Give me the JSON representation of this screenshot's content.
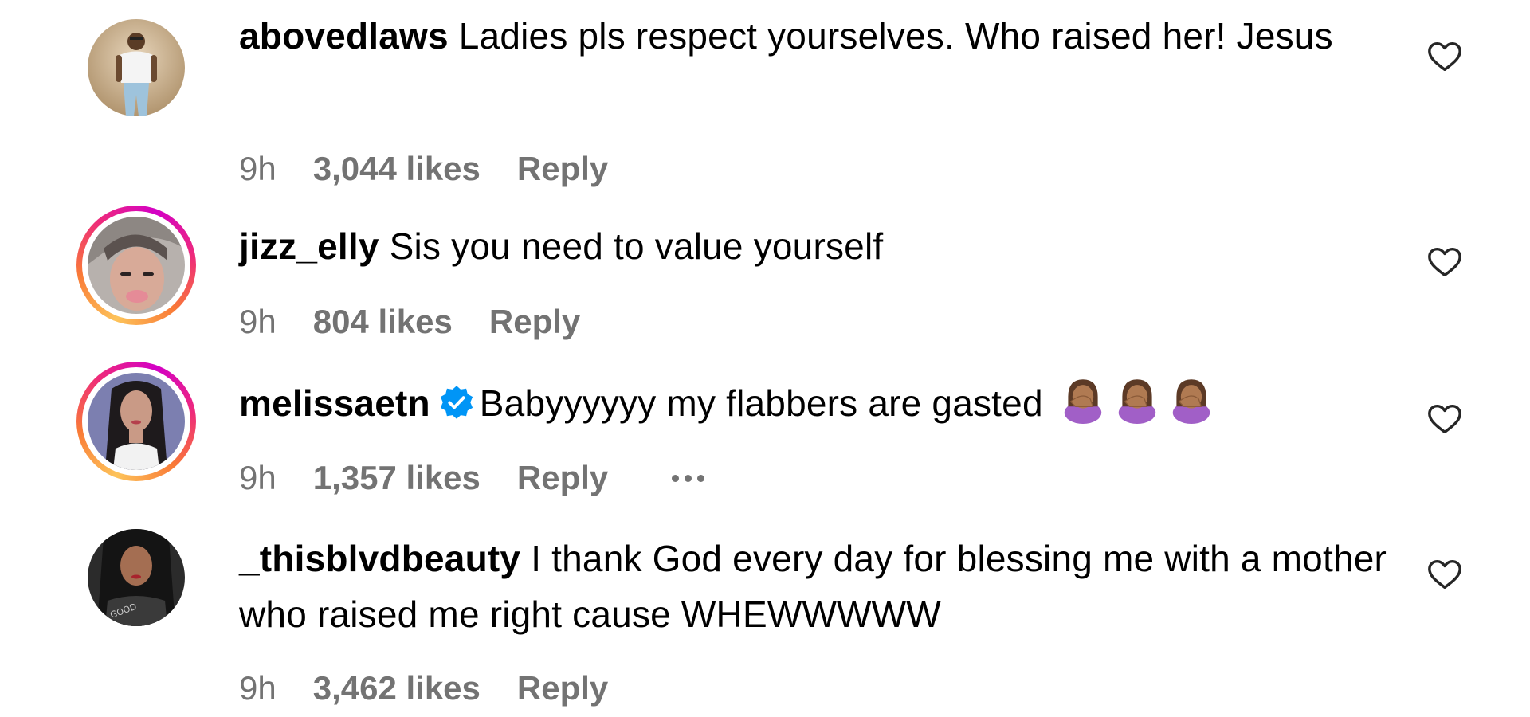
{
  "comments": [
    {
      "username": "abovedlaws",
      "text": "Ladies pls respect yourselves. Who raised her! Jesus",
      "verified": false,
      "time": "9h",
      "likes": "3,044 likes",
      "reply_label": "Reply",
      "has_story_ring": false
    },
    {
      "username": "jizz_elly",
      "text": "Sis you need to value yourself",
      "verified": false,
      "time": "9h",
      "likes": "804 likes",
      "reply_label": "Reply",
      "has_story_ring": true
    },
    {
      "username": "melissaetn",
      "text": "Babyyyyyy my flabbers are gasted",
      "emoji": "woman-facepalming-medium-skin-tone",
      "emoji_count": 3,
      "verified": true,
      "time": "9h",
      "likes": "1,357 likes",
      "reply_label": "Reply",
      "has_story_ring": true,
      "more_icon": "more-horizontal-icon"
    },
    {
      "username": "_thisblvdbeauty",
      "text": "I thank God every day for blessing me with a mother who raised me right cause WHEWWWWW",
      "verified": false,
      "time": "9h",
      "likes": "3,462 likes",
      "reply_label": "Reply",
      "has_story_ring": false
    }
  ],
  "icons": {
    "like": "heart-outline-icon",
    "verified": "verified-badge-icon"
  },
  "colors": {
    "text": "#000000",
    "meta": "#737373",
    "verified": "#0095f6",
    "story_ring": "#ee2a7b"
  }
}
